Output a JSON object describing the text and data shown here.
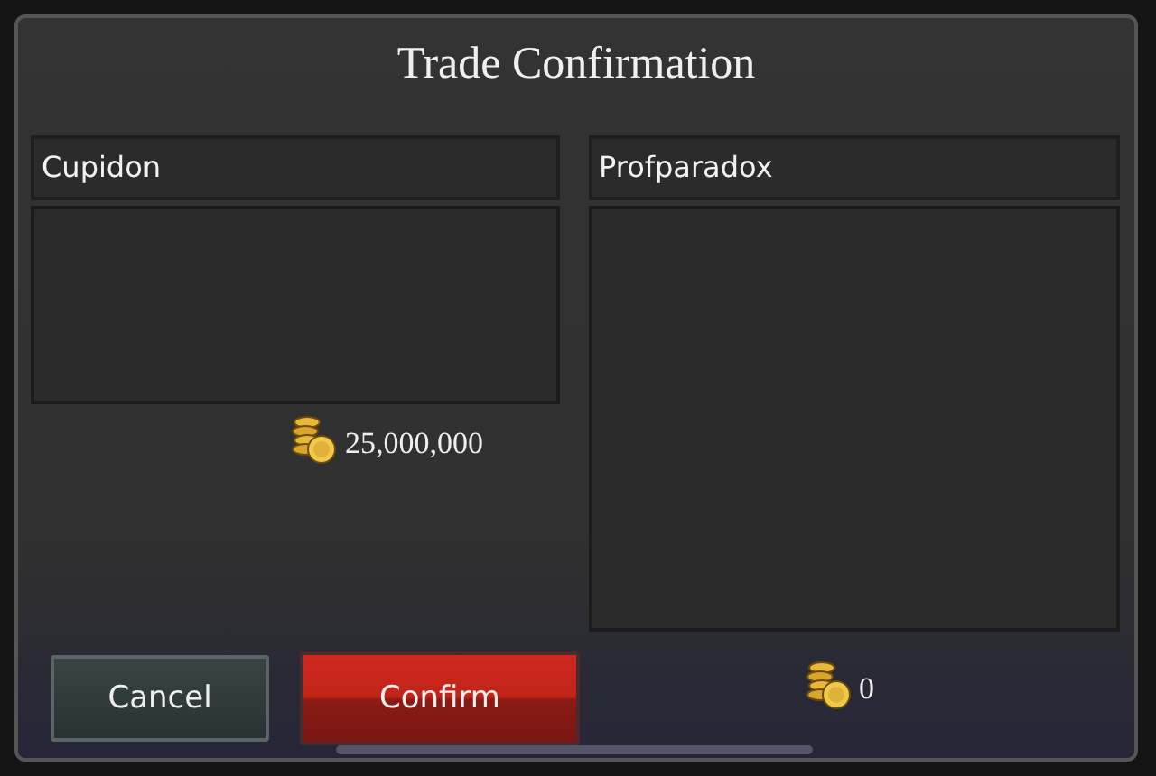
{
  "dialog": {
    "title": "Trade Confirmation",
    "offers": [
      {
        "player": "Cupidon",
        "gold": "25,000,000"
      },
      {
        "player": "Profparadox",
        "gold": "0"
      }
    ],
    "buttons": [
      {
        "kind": "cancel",
        "label": "Cancel"
      },
      {
        "kind": "confirm",
        "label": "Confirm"
      }
    ]
  }
}
